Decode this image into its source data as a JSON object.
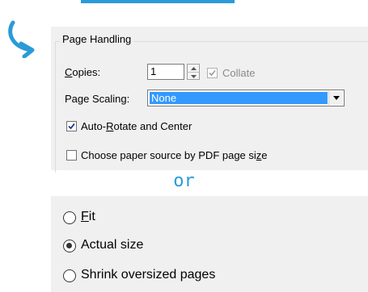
{
  "page_handling": {
    "title": "Page Handling",
    "copies": {
      "label_underlined": "C",
      "label_rest": "opies:",
      "value": "1"
    },
    "collate_label": "Collate",
    "page_scaling": {
      "label": "Page Scaling:",
      "value": "None"
    },
    "auto_rotate": {
      "pre": "Auto-",
      "underlined": "R",
      "post": "otate and Center"
    },
    "choose_paper": {
      "pre": "Choose paper source by PDF page si",
      "underlined": "z",
      "post": "e"
    }
  },
  "separator": "or",
  "scaling_options": {
    "fit": {
      "underlined": "F",
      "rest": "it"
    },
    "actual_size": "Actual size",
    "shrink": "Shrink oversized pages"
  },
  "colors": {
    "accent": "#2a9bd8",
    "selection": "#3399ff",
    "panel_bg": "#f0f0f0"
  },
  "icons": {
    "arrow": "curved-arrow-icon",
    "dropdown": "chevron-down-icon",
    "spinner_up": "caret-up-icon",
    "spinner_down": "caret-down-icon",
    "check": "check-icon"
  }
}
